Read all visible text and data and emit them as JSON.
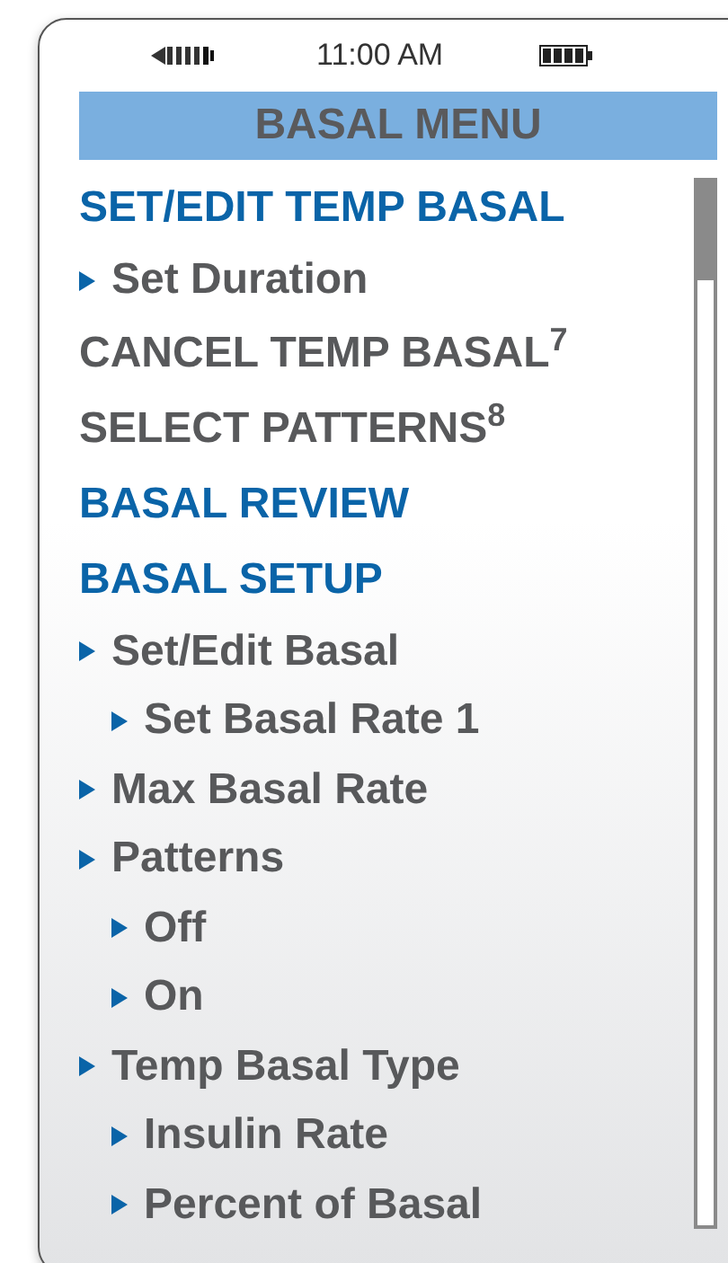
{
  "status_bar": {
    "time": "11:00 AM"
  },
  "header": {
    "title": "BASAL MENU"
  },
  "menu": [
    {
      "label": "SET/EDIT TEMP BASAL",
      "disabled": false,
      "children": [
        {
          "label": "Set Duration"
        }
      ]
    },
    {
      "label": "CANCEL TEMP BASAL$^{7}$",
      "disabled": true
    },
    {
      "label": "SELECT PATTERNS$^{8}$",
      "disabled": true
    },
    {
      "label": "BASAL REVIEW",
      "disabled": false
    },
    {
      "label": "BASAL SETUP",
      "disabled": false,
      "children": [
        {
          "label": "Set/Edit Basal",
          "children": [
            {
              "label": "Set Basal Rate 1"
            }
          ]
        },
        {
          "label": "Max Basal Rate"
        },
        {
          "label": "Patterns",
          "children": [
            {
              "label": "Off"
            },
            {
              "label": "On"
            }
          ]
        },
        {
          "label": "Temp Basal Type",
          "children": [
            {
              "label": "Insulin Rate"
            },
            {
              "label": "Percent of Basal"
            }
          ]
        }
      ]
    }
  ]
}
